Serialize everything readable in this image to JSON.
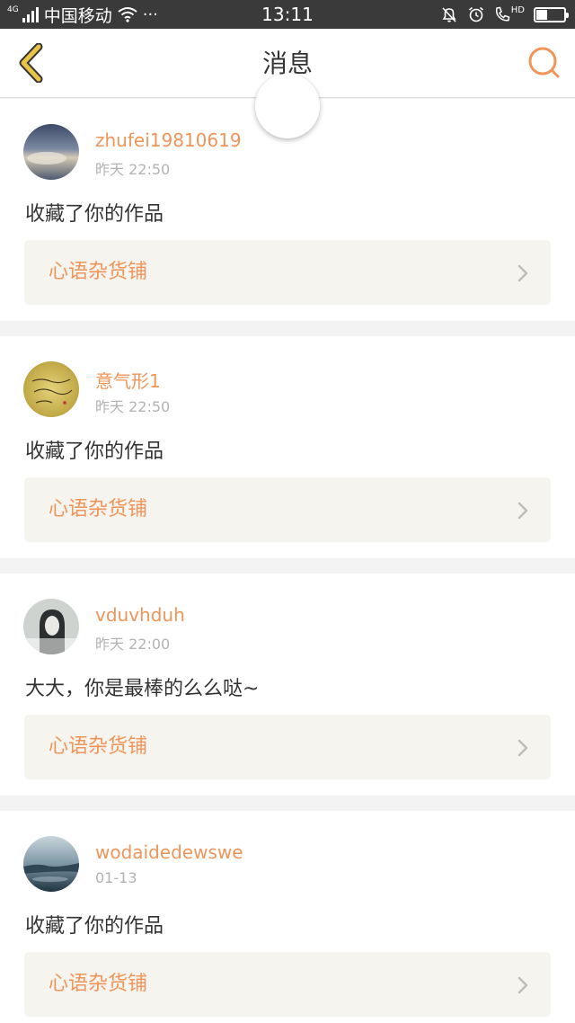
{
  "status_bar": {
    "network_type": "4G",
    "carrier": "中国移动",
    "more": "···",
    "time": "13:11",
    "hd": "HD",
    "battery_level": 0.4
  },
  "nav": {
    "title": "消息",
    "accent_color": "#f0955a",
    "back_color": "#e8c547"
  },
  "messages": [
    {
      "user": "zhufei19810619",
      "time": "昨天 22:50",
      "text": "收藏了你的作品",
      "work": "心语杂货铺"
    },
    {
      "user": "意气形1",
      "time": "昨天 22:50",
      "text": "收藏了你的作品",
      "work": "心语杂货铺"
    },
    {
      "user": "vduvhduh",
      "time": "昨天 22:00",
      "text": "大大，你是最棒的么么哒~",
      "work": "心语杂货铺"
    },
    {
      "user": "wodaidedewswe",
      "time": "01-13",
      "text": "收藏了你的作品",
      "work": "心语杂货铺"
    }
  ]
}
